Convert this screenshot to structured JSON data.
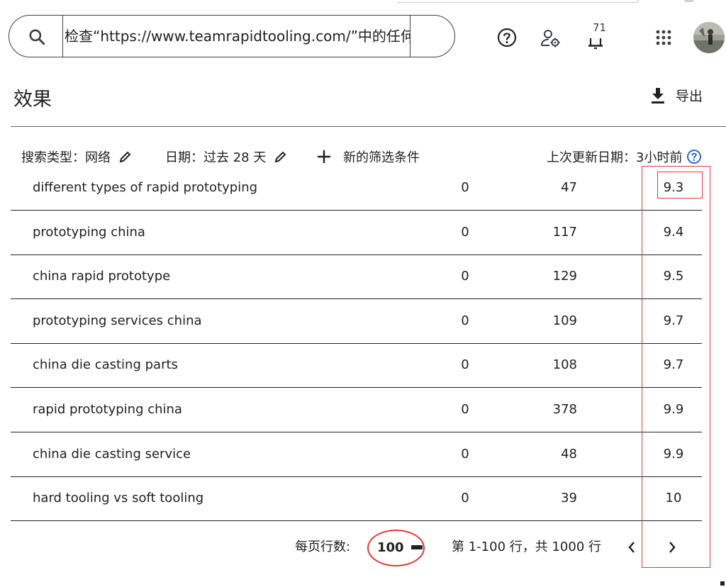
{
  "search": {
    "value": "检查“https://www.teamrapidtooling.com/”中的任何网"
  },
  "header": {
    "help_icon": "help-circle-icon",
    "admin_icon": "user-settings-icon",
    "notifications": {
      "icon": "bell-icon",
      "count": "71"
    },
    "apps_icon": "apps-grid-icon"
  },
  "page": {
    "title": "效果",
    "export_label": "导出"
  },
  "filters": {
    "search_type": "搜索类型：网络",
    "date": "日期：过去 28 天",
    "new_filter": "新的筛选条件",
    "last_updated": "上次更新日期：3小时前"
  },
  "table": {
    "rows": [
      {
        "query": "different types of rapid prototyping",
        "clicks": "0",
        "impressions": "47",
        "position": "9.3"
      },
      {
        "query": "prototyping china",
        "clicks": "0",
        "impressions": "117",
        "position": "9.4"
      },
      {
        "query": "china rapid prototype",
        "clicks": "0",
        "impressions": "129",
        "position": "9.5"
      },
      {
        "query": "prototyping services china",
        "clicks": "0",
        "impressions": "109",
        "position": "9.7"
      },
      {
        "query": "china die casting parts",
        "clicks": "0",
        "impressions": "108",
        "position": "9.7"
      },
      {
        "query": "rapid prototyping china",
        "clicks": "0",
        "impressions": "378",
        "position": "9.9"
      },
      {
        "query": "china die casting service",
        "clicks": "0",
        "impressions": "48",
        "position": "9.9"
      },
      {
        "query": "hard tooling vs soft tooling",
        "clicks": "0",
        "impressions": "39",
        "position": "10"
      }
    ]
  },
  "pagination": {
    "rows_per_page_label": "每页行数:",
    "rows_per_page": "100",
    "range": "第 1-100 行，共 1000 行"
  },
  "colors": {
    "annotation": "#e53935",
    "text": "#202124",
    "rule": "#202124"
  }
}
